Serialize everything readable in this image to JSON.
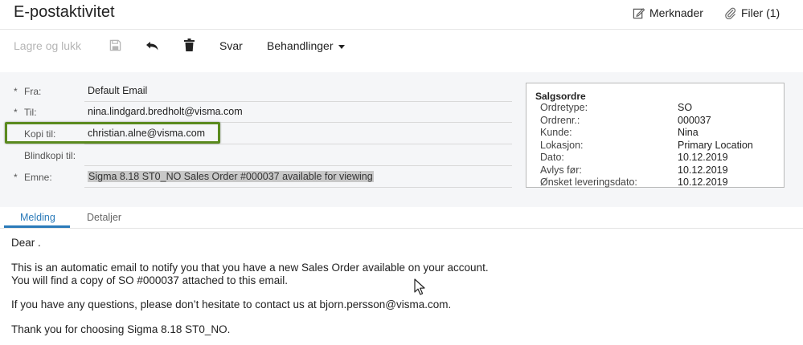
{
  "header": {
    "title": "E-postaktivitet",
    "notes_label": "Merknader",
    "files_label": "Filer (1)"
  },
  "toolbar": {
    "save_close_label": "Lagre og lukk",
    "reply_label": "Svar",
    "actions_label": "Behandlinger"
  },
  "form": {
    "from": {
      "label": "Fra:",
      "value": "Default Email",
      "required": "*"
    },
    "to": {
      "label": "Til:",
      "value": "nina.lindgard.bredholt@visma.com",
      "required": "*"
    },
    "cc": {
      "label": "Kopi til:",
      "value": "christian.alne@visma.com"
    },
    "bcc": {
      "label": "Blindkopi til:",
      "value": ""
    },
    "subject": {
      "label": "Emne:",
      "value": "Sigma 8.18 ST0_NO Sales Order #000037 available for viewing",
      "required": "*"
    }
  },
  "sales_order": {
    "title": "Salgsordre",
    "rows": [
      {
        "label": "Ordretype:",
        "value": "SO"
      },
      {
        "label": "Ordrenr.:",
        "value": "000037"
      },
      {
        "label": "Kunde:",
        "value": "Nina"
      },
      {
        "label": "Lokasjon:",
        "value": "Primary Location"
      },
      {
        "label": "Dato:",
        "value": "10.12.2019"
      },
      {
        "label": "Avlys før:",
        "value": "10.12.2019"
      },
      {
        "label": "Ønsket leveringsdato:",
        "value": "10.12.2019"
      }
    ]
  },
  "tabs": [
    {
      "label": "Melding"
    },
    {
      "label": "Detaljer"
    }
  ],
  "message": {
    "line1": "Dear .",
    "line2": "This is an automatic email to notify you that you have a new Sales Order available on your account.",
    "line3": "You will find a copy of SO #000037 attached to this email.",
    "line4": "If you have any questions, please don’t hesitate to contact us at bjorn.persson@visma.com.",
    "line5": "Thank you for choosing Sigma 8.18 ST0_NO."
  },
  "colors": {
    "accent": "#2a7ab9",
    "highlight_border": "#5a8a1e",
    "disabled_text": "#b5b5b5"
  }
}
